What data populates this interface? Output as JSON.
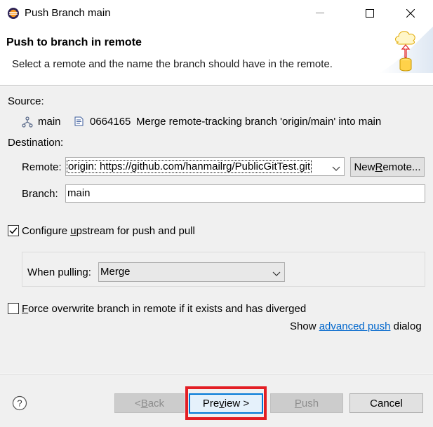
{
  "window": {
    "title": "Push Branch main"
  },
  "banner": {
    "title": "Push to branch in remote",
    "description": "Select a remote and the name the branch should have in the remote."
  },
  "source": {
    "label": "Source:",
    "branch": "main",
    "commit_id": "0664165",
    "commit_message": "Merge remote-tracking branch 'origin/main' into main"
  },
  "destination": {
    "label": "Destination:",
    "remote_label": "Remote:",
    "remote_value": "origin: https://github.com/hanmailrg/PublicGitTest.git",
    "new_remote_prefix": "New ",
    "new_remote_mnemonic": "R",
    "new_remote_suffix": "emote...",
    "branch_label": "Branch:",
    "branch_value": "main"
  },
  "upstream": {
    "checked": true,
    "label_prefix": "Configure ",
    "label_mnemonic": "u",
    "label_suffix": "pstream for push and pull",
    "when_pulling_label": "When pulling:",
    "when_pulling_value": "Merge"
  },
  "force": {
    "checked": false,
    "label_mnemonic": "F",
    "label_suffix": "orce overwrite branch in remote if it exists and has diverged"
  },
  "advanced": {
    "prefix": "Show ",
    "link": "advanced push",
    "suffix": " dialog"
  },
  "buttons": {
    "back_prefix": "< ",
    "back_mnemonic": "B",
    "back_suffix": "ack",
    "preview_prefix": "Pre",
    "preview_mnemonic": "v",
    "preview_suffix": "iew >",
    "push_mnemonic": "P",
    "push_suffix": "ush",
    "cancel": "Cancel"
  },
  "colors": {
    "highlight": "#e31e24",
    "link": "#0066cc",
    "default_button_border": "#0078d7"
  },
  "icons": {
    "app": "eclipse-icon",
    "help": "help-icon",
    "banner": "push-to-cloud-icon",
    "branch": "branch-icon",
    "commit": "commit-icon"
  }
}
